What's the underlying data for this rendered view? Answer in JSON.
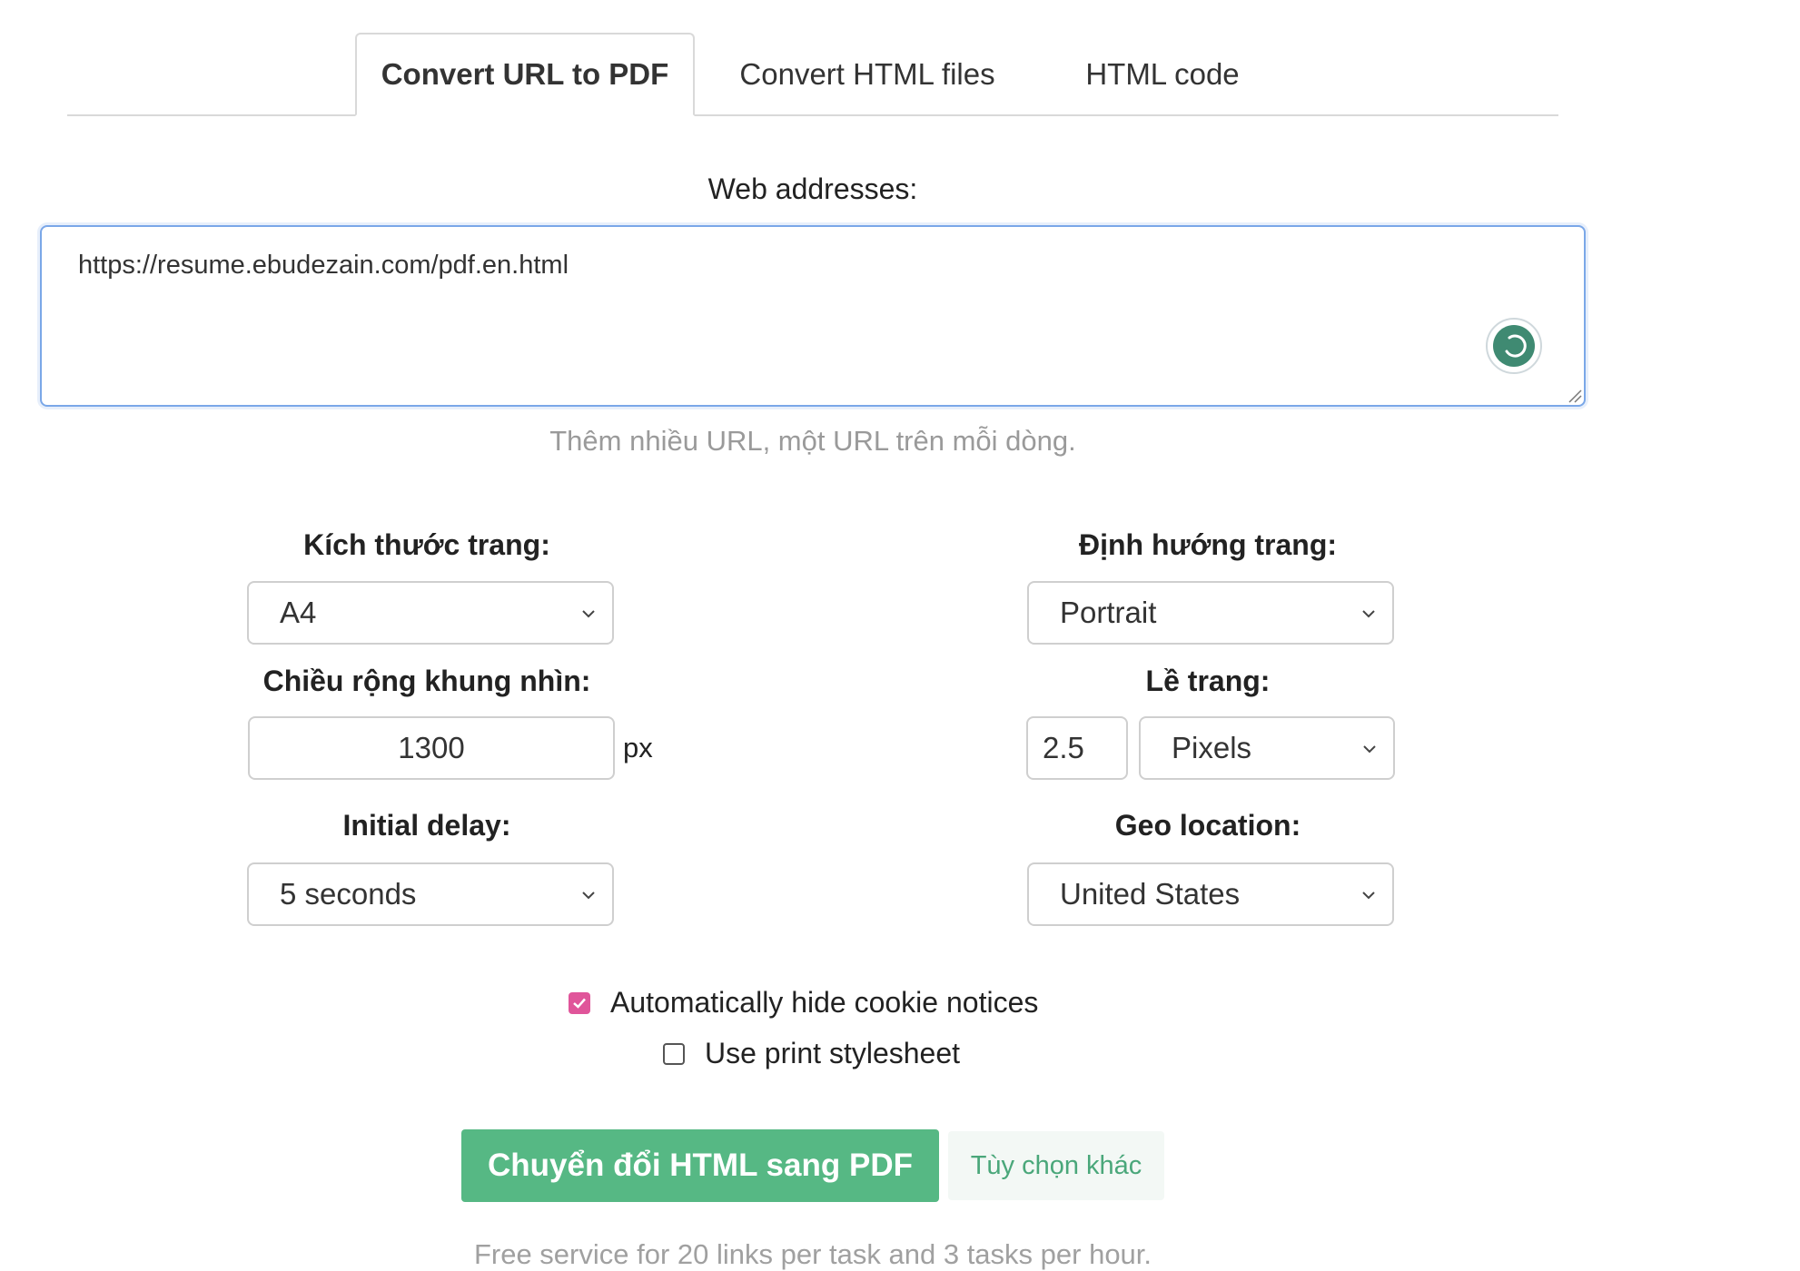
{
  "tabs": [
    {
      "label": "Convert URL to PDF",
      "active": true
    },
    {
      "label": "Convert HTML files",
      "active": false
    },
    {
      "label": "HTML code",
      "active": false
    }
  ],
  "web_addresses": {
    "label": "Web addresses:",
    "value": "https://resume.ebudezain.com/pdf.en.html",
    "hint": "Thêm nhiều URL, một URL trên mỗi dòng."
  },
  "options": {
    "page_size": {
      "label": "Kích thước trang:",
      "value": "A4"
    },
    "orientation": {
      "label": "Định hướng trang:",
      "value": "Portrait"
    },
    "viewport_width": {
      "label": "Chiều rộng khung nhìn:",
      "value": "1300",
      "unit": "px"
    },
    "margin": {
      "label": "Lề trang:",
      "value": "2.5",
      "unit_value": "Pixels"
    },
    "initial_delay": {
      "label": "Initial delay:",
      "value": "5 seconds"
    },
    "geo_location": {
      "label": "Geo location:",
      "value": "United States"
    }
  },
  "checkboxes": [
    {
      "label": "Automatically hide cookie notices",
      "checked": true
    },
    {
      "label": "Use print stylesheet",
      "checked": false
    }
  ],
  "actions": {
    "convert_label": "Chuyển đổi HTML sang PDF",
    "more_options_label": "Tùy chọn khác"
  },
  "footer_note": "Free service for 20 links per task and 3 tasks per hour.",
  "colors": {
    "primary": "#56b884",
    "checkbox_accent": "#e0559a",
    "focus_border": "#7aa7e8",
    "spinner": "#3f8a72"
  },
  "icons": [
    "loading-spinner-icon",
    "chevron-down-icon",
    "resize-grip-icon",
    "checkmark-icon"
  ]
}
